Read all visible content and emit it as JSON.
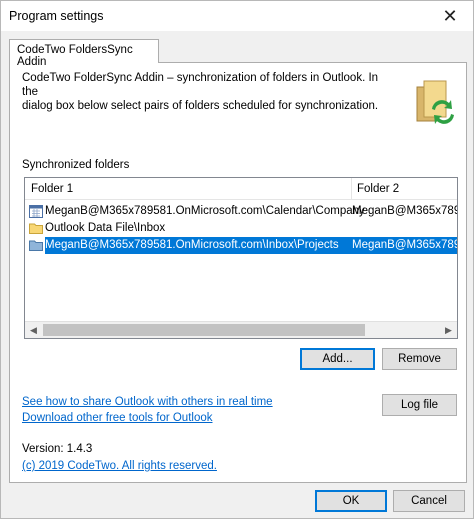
{
  "window": {
    "title": "Program settings",
    "close_glyph": "✕"
  },
  "tabs": [
    {
      "label": "CodeTwo FoldersSync Addin"
    }
  ],
  "description": {
    "line1": "CodeTwo FolderSync Addin – synchronization of folders in Outlook. In the",
    "line2": "dialog box below select pairs of folders scheduled for synchronization."
  },
  "app_icon": "folder-sync-icon",
  "synced_section": {
    "label": "Synchronized folders",
    "columns": [
      "Folder 1",
      "Folder 2"
    ],
    "rows": [
      {
        "icon": "calendar-icon",
        "folder1": "MeganB@M365x789581.OnMicrosoft.com\\Calendar\\Company",
        "folder2": "MeganB@M365x789",
        "selected": false
      },
      {
        "icon": "folder-icon",
        "folder1": "Outlook Data File\\Inbox",
        "folder2": "",
        "selected": false
      },
      {
        "icon": "mail-folder-icon",
        "folder1": "MeganB@M365x789581.OnMicrosoft.com\\Inbox\\Projects",
        "folder2": "MeganB@M365x789",
        "selected": true
      }
    ]
  },
  "buttons": {
    "add": "Add...",
    "remove": "Remove",
    "log_file": "Log file",
    "ok": "OK",
    "cancel": "Cancel"
  },
  "links": {
    "share": "See how to share Outlook with others in real time",
    "download": "Download other free tools for Outlook",
    "copyright": "(c) 2019 CodeTwo. All rights reserved."
  },
  "version": "Version: 1.4.3",
  "colors": {
    "selection": "#0078d7",
    "link": "#0066cc"
  }
}
